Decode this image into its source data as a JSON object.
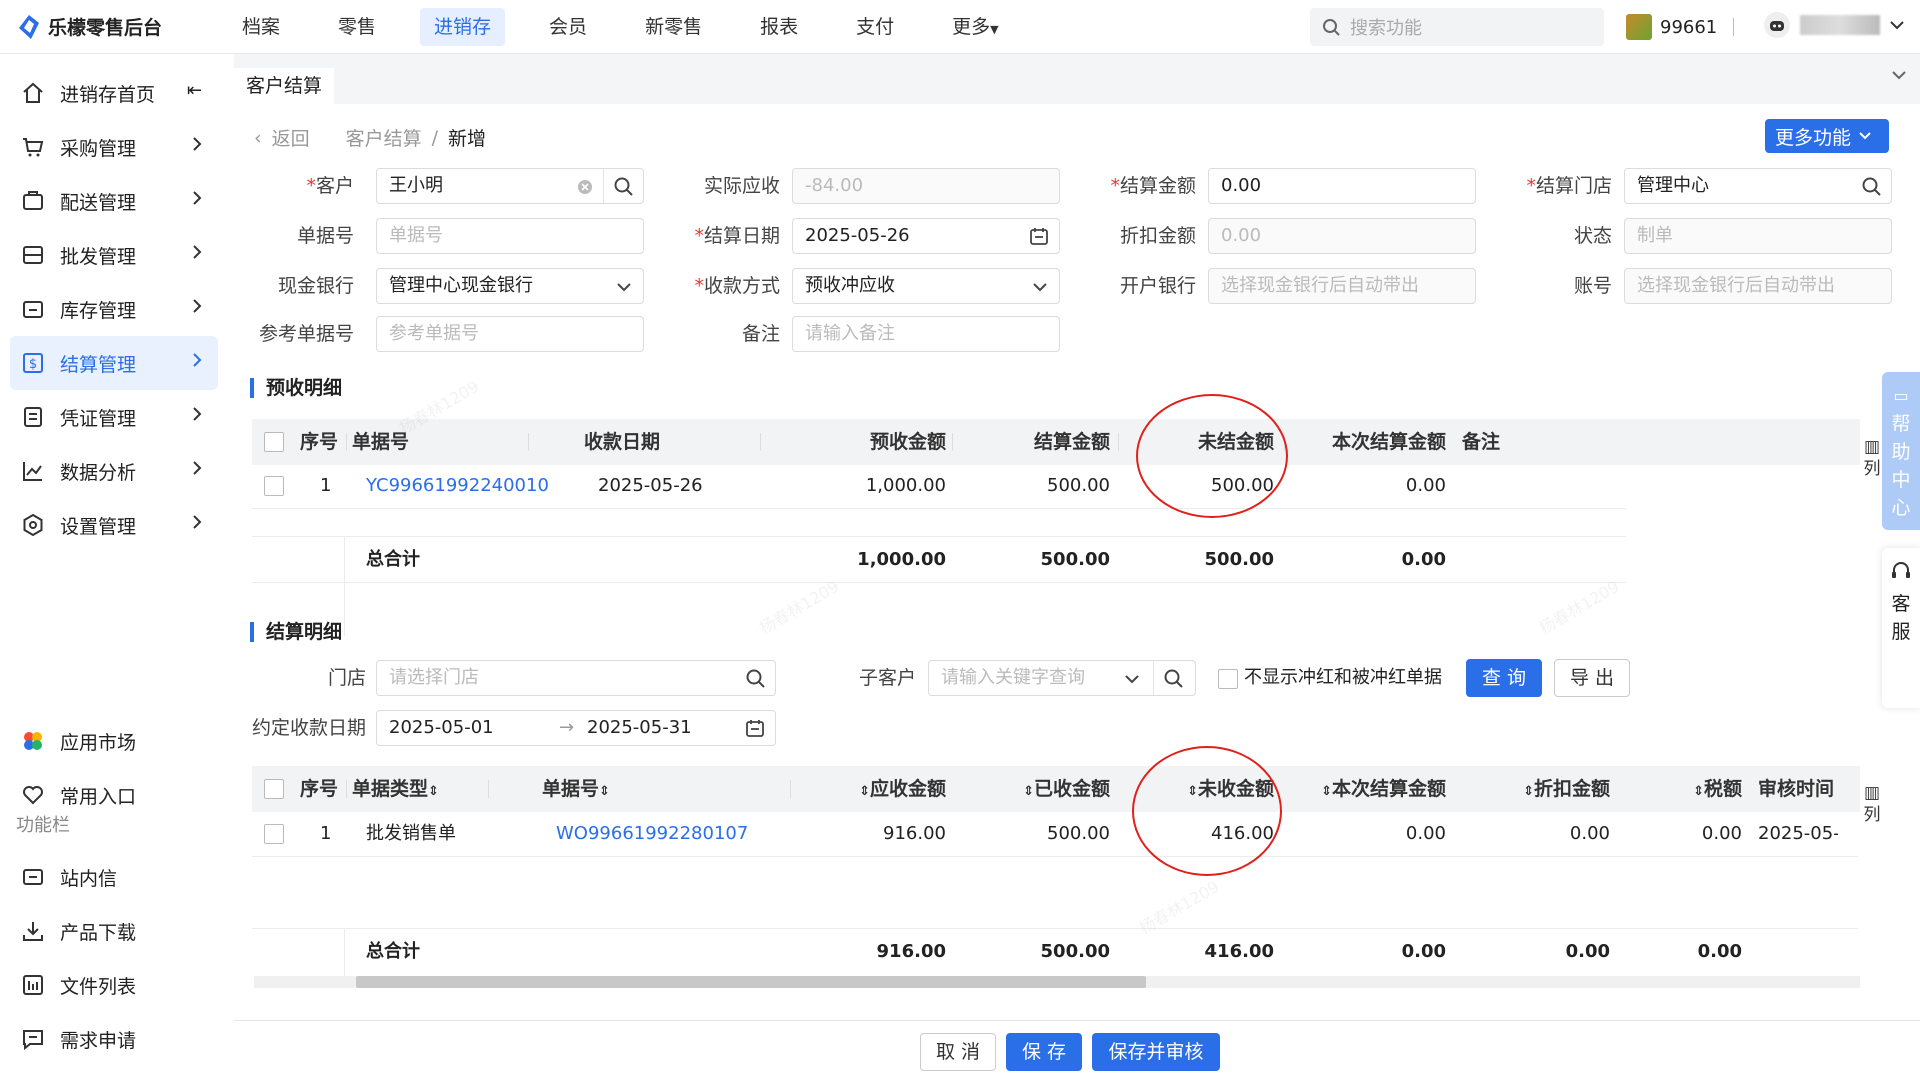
{
  "app": {
    "title": "乐檬零售后台"
  },
  "topnav": [
    "档案",
    "零售",
    "进销存",
    "会员",
    "新零售",
    "报表",
    "支付",
    "更多"
  ],
  "topnav_active": 2,
  "search": {
    "placeholder": "搜索功能"
  },
  "account": {
    "id": "99661"
  },
  "sidebar": {
    "items": [
      "进销存首页",
      "采购管理",
      "配送管理",
      "批发管理",
      "库存管理",
      "结算管理",
      "凭证管理",
      "数据分析",
      "设置管理"
    ],
    "extra": [
      "应用市场",
      "常用入口"
    ],
    "group_label": "功能栏",
    "tools": [
      "站内信",
      "产品下载",
      "文件列表",
      "需求申请"
    ]
  },
  "tab": {
    "label": "客户结算"
  },
  "breadcrumb": {
    "back": "返回",
    "parent": "客户结算",
    "separator": "/",
    "current": "新增"
  },
  "more_button": "更多功能",
  "form": {
    "customer_label": "客户",
    "customer_value": "王小明",
    "actual_label": "实际应收",
    "actual_value": "-84.00",
    "settle_amt_label": "结算金额",
    "settle_amt_value": "0.00",
    "store_label": "结算门店",
    "store_value": "管理中心",
    "docno_label": "单据号",
    "docno_placeholder": "单据号",
    "settle_date_label": "结算日期",
    "settle_date_value": "2025-05-26",
    "discount_label": "折扣金额",
    "discount_value": "0.00",
    "status_label": "状态",
    "status_value": "制单",
    "cashbank_label": "现金银行",
    "cashbank_value": "管理中心现金银行",
    "paymode_label": "收款方式",
    "paymode_value": "预收冲应收",
    "openbank_label": "开户银行",
    "openbank_placeholder": "选择现金银行后自动带出",
    "account_label": "账号",
    "account_placeholder": "选择现金银行后自动带出",
    "refno_label": "参考单据号",
    "refno_placeholder": "参考单据号",
    "remark_label": "备注",
    "remark_placeholder": "请输入备注"
  },
  "prepay": {
    "title": "预收明细",
    "headers": [
      "序号",
      "单据号",
      "收款日期",
      "预收金额",
      "结算金额",
      "未结金额",
      "本次结算金额",
      "备注"
    ],
    "rows": [
      {
        "seq": "1",
        "docno": "YC99661992240010",
        "date": "2025-05-26",
        "prepay": "1,000.00",
        "settled": "500.00",
        "unsettled": "500.00",
        "this": "0.00"
      }
    ],
    "total": {
      "label": "总合计",
      "prepay": "1,000.00",
      "settled": "500.00",
      "unsettled": "500.00",
      "this": "0.00"
    },
    "col_settings": "列"
  },
  "settle": {
    "title": "结算明细",
    "store_label": "门店",
    "store_placeholder": "请选择门店",
    "sub_label": "子客户",
    "sub_placeholder": "请输入关键字查询",
    "hide_label": "不显示冲红和被冲红单据",
    "query_btn": "查 询",
    "export_btn": "导 出",
    "date_label": "约定收款日期",
    "date_start": "2025-05-01",
    "date_end": "2025-05-31",
    "headers": [
      "序号",
      "单据类型",
      "单据号",
      "应收金额",
      "已收金额",
      "未收金额",
      "本次结算金额",
      "折扣金额",
      "税额",
      "审核时间"
    ],
    "rows": [
      {
        "seq": "1",
        "type": "批发销售单",
        "docno": "WO99661992280107",
        "due": "916.00",
        "received": "500.00",
        "unreceived": "416.00",
        "this": "0.00",
        "discount": "0.00",
        "tax": "0.00",
        "audit": "2025-05-"
      }
    ],
    "total": {
      "label": "总合计",
      "due": "916.00",
      "received": "500.00",
      "unreceived": "416.00",
      "this": "0.00",
      "discount": "0.00",
      "tax": "0.00"
    },
    "col_settings": "列"
  },
  "footer": {
    "cancel": "取 消",
    "save": "保 存",
    "save_audit": "保存并审核"
  },
  "float": {
    "help": [
      "帮",
      "助",
      "中",
      "心"
    ],
    "service": [
      "客",
      "服"
    ]
  },
  "watermark_text": "杨春林1209",
  "colors": {
    "accent": "#2a6ee8",
    "annotation": "#e0211b"
  }
}
